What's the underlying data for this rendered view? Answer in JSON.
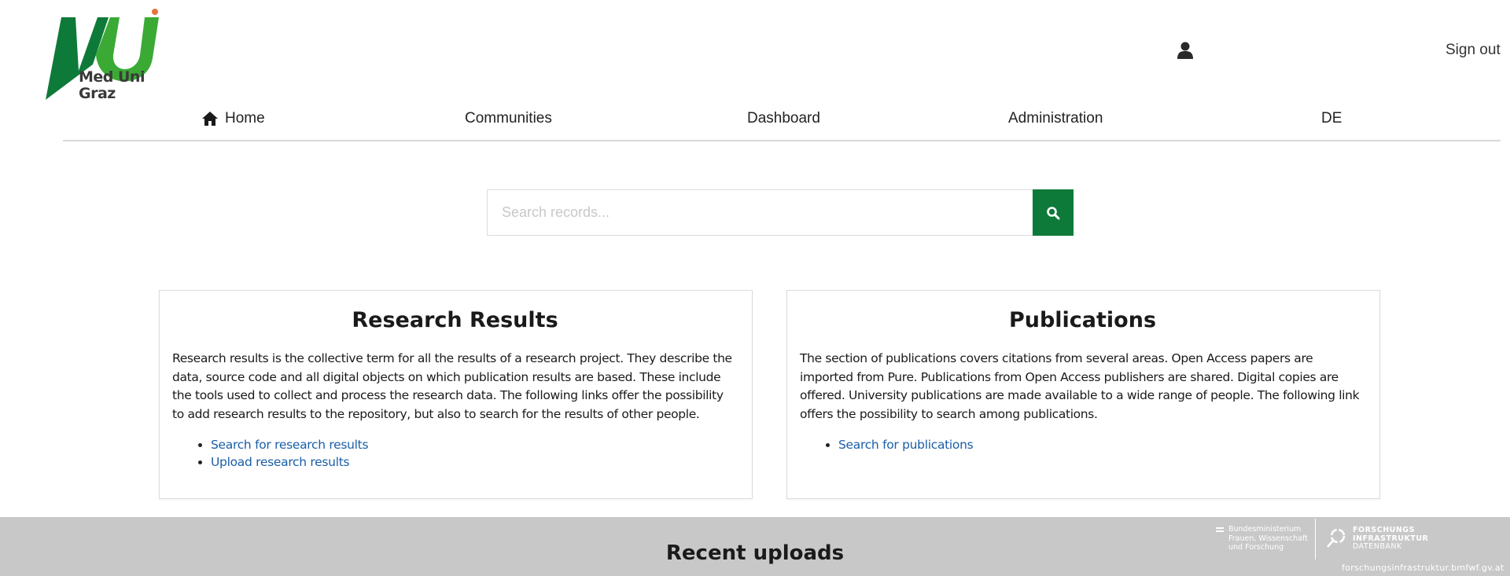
{
  "header": {
    "logo_text_line1": "Med Uni",
    "logo_text_line2": "Graz",
    "user_icon": "user-icon",
    "signout_label": "Sign out"
  },
  "nav": {
    "home_icon": "home-icon",
    "items": [
      {
        "label": "Home"
      },
      {
        "label": "Communities"
      },
      {
        "label": "Dashboard"
      },
      {
        "label": "Administration"
      },
      {
        "label": "DE"
      }
    ]
  },
  "search": {
    "placeholder": "Search records...",
    "value": "",
    "button_icon": "search-icon"
  },
  "cards": [
    {
      "title": "Research Results",
      "body": "Research results is the collective term for all the results of a research project. They describe the data, source code and all digital objects on which publication results are based. These include the tools used to collect and process the research data. The following links offer the possibility to add research results to the repository, but also to search for the results of other people.",
      "links": [
        "Search for research results",
        "Upload research results"
      ]
    },
    {
      "title": "Publications",
      "body": "The section of publications covers citations from several areas. Open Access papers are imported from Pure. Publications from Open Access publishers are shared. Digital copies are offered. University publications are made available to a wide range of people. The following link offers the possibility to search among publications.",
      "links": [
        "Search for publications"
      ]
    }
  ],
  "footer": {
    "recent_uploads": "Recent uploads",
    "ministry_text": "Bundesministerium\nFrauen, Wissenschaft\nund Forschung",
    "fi_line1": "FORSCHUNGS",
    "fi_line2": "INFRASTRUKTUR",
    "fi_line3": "DATENBANK",
    "fi_url": "forschungsinfrastruktur.bmfwf.gv.at"
  },
  "colors": {
    "brand_green": "#0e7a39",
    "logo_green_light": "#3aaa35",
    "logo_orange": "#e8743b",
    "link_blue": "#1a5ea8",
    "footer_gray": "#c8c8c8"
  }
}
